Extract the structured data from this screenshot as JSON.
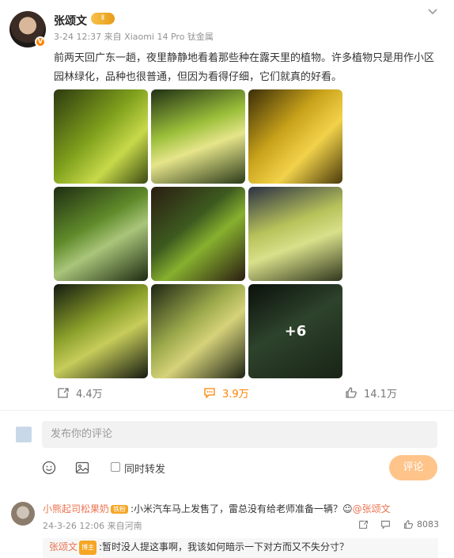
{
  "post": {
    "author": "张颂文",
    "level_badge": "Ⅱ",
    "verified_mark": "V",
    "meta": "3-24 12:37  来自 Xiaomi 14 Pro 钛金属",
    "text": "前两天回广东一趟，夜里静静地看着那些种在露天里的植物。许多植物只是用作小区园林绿化，品种也很普通，但因为看得仔细，它们就真的好看。",
    "more_photos": "+6",
    "repost_count": "4.4万",
    "comment_count": "3.9万",
    "like_count": "14.1万"
  },
  "comment_box": {
    "placeholder": "发布你的评论",
    "repost_label": "同时转发",
    "submit_label": "评论"
  },
  "comment": {
    "user": "小熊起司松果奶",
    "user_badge": "铁粉",
    "text": ":小米汽车马上发售了，雷总没有给老师准备一辆？",
    "mention": "@张颂文",
    "meta": "24-3-26 12:06 来自河南",
    "likes": "8083"
  },
  "reply": {
    "user": "张颂文",
    "badge": "博主",
    "text": ":暂时没人提这事啊，我该如何暗示一下对方而又不失分寸？"
  },
  "colors": {
    "accent": "#ff8200",
    "link": "#eb7350"
  }
}
